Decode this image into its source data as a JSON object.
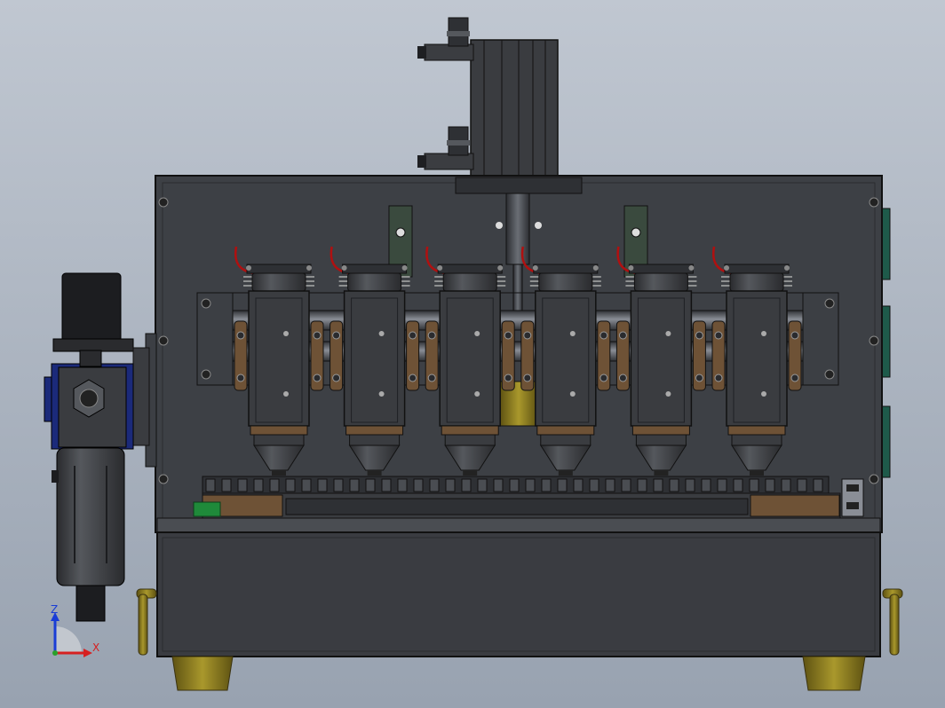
{
  "viewport": {
    "background_top": "#bfc6d0",
    "background_bottom": "#9aa4b2"
  },
  "colors": {
    "frame": "#3c3f44",
    "frame_dark": "#2b2d31",
    "bronze": "#6e5236",
    "brass": "#8a7a22",
    "red_wire": "#b01010",
    "green_part": "#1f8a3a",
    "regulator_blue": "#1b2a7a"
  },
  "machine": {
    "units": 6
  },
  "triad": {
    "z_label": "Z",
    "x_label": "X",
    "z_color": "#1a3dd6",
    "x_color": "#d62020"
  }
}
